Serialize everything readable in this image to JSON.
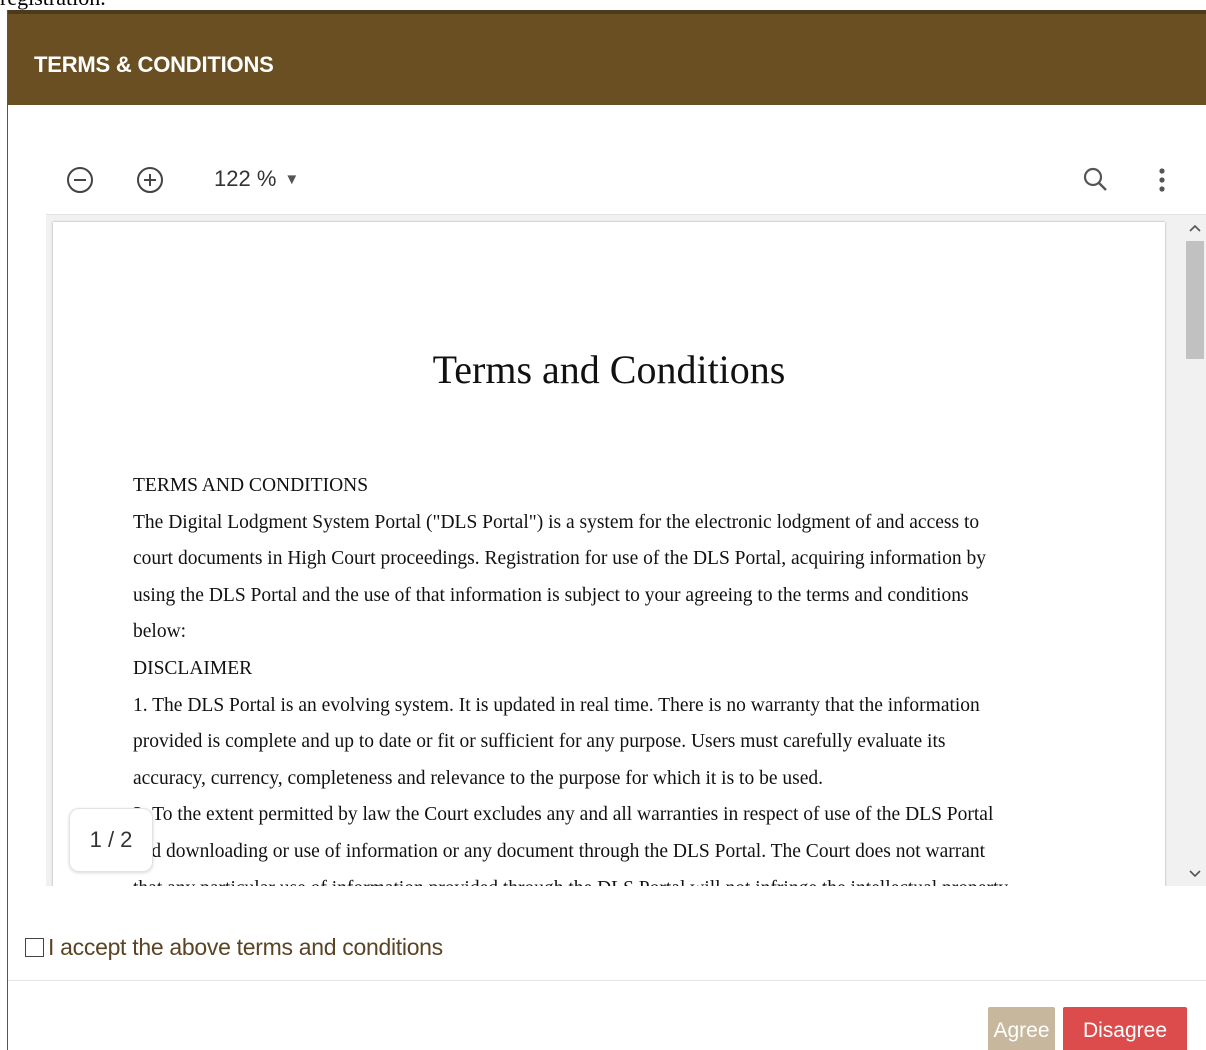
{
  "background_text": "registration.",
  "modal": {
    "title": "TERMS & CONDITIONS",
    "header_color": "#6a4f23"
  },
  "viewer": {
    "zoom_out_icon": "zoom-out-icon",
    "zoom_in_icon": "zoom-in-icon",
    "zoom_level": "122 %",
    "zoom_caret": "▼",
    "search_icon": "search-icon",
    "more_icon": "more-vertical-icon",
    "page_indicator": "1 / 2"
  },
  "document": {
    "title": "Terms and Conditions",
    "lines": [
      "TERMS AND CONDITIONS",
      "The Digital Lodgment System Portal (\"DLS Portal\") is a system for the electronic lodgment of and access to",
      "court documents in High Court proceedings.  Registration for use of the DLS Portal, acquiring information by",
      "using the DLS Portal and the use of that information is subject to your agreeing to the terms and conditions",
      "below:",
      "DISCLAIMER",
      "1. The DLS Portal is an evolving system.  It is updated in real time.  There is no warranty that the information",
      "provided is complete and up to date or fit or sufficient for any purpose.  Users must carefully evaluate its",
      "accuracy, currency, completeness and relevance to the purpose for which it is to be used.",
      "2. To the extent permitted by law the Court excludes any and all warranties in respect of use of the DLS Portal",
      "and downloading or use of information or any document through the DLS Portal. The Court does not warrant",
      "that any particular use of information provided through the DLS Portal will not infringe the intellectual property"
    ]
  },
  "accept": {
    "label": "I accept the above terms and conditions",
    "checked": false
  },
  "buttons": {
    "agree": "Agree",
    "disagree": "Disagree",
    "agree_color": "#c7b79c",
    "disagree_color": "#dd4c4c"
  }
}
